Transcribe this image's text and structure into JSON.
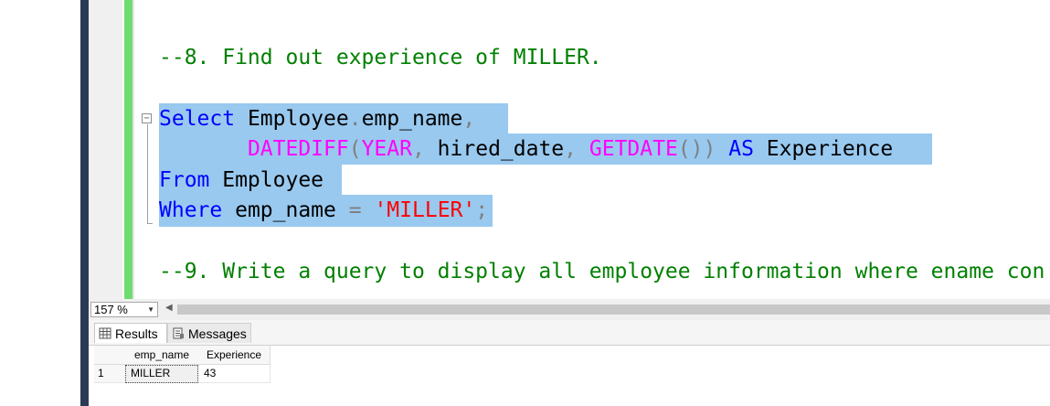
{
  "editor": {
    "lines": [
      [
        {
          "t": "--8. Find out experience of MILLER.",
          "c": "c-comment"
        }
      ],
      [
        {
          "t": "Select",
          "c": "c-kw"
        },
        {
          "t": " Employee",
          "c": "c-id"
        },
        {
          "t": ".",
          "c": "c-punct"
        },
        {
          "t": "emp_name",
          "c": "c-id"
        },
        {
          "t": ",",
          "c": "c-punct"
        }
      ],
      [
        {
          "t": "       ",
          "c": "c-id"
        },
        {
          "t": "DATEDIFF",
          "c": "c-fn"
        },
        {
          "t": "(",
          "c": "c-punct"
        },
        {
          "t": "YEAR",
          "c": "c-fn"
        },
        {
          "t": ",",
          "c": "c-punct"
        },
        {
          "t": " hired_date",
          "c": "c-id"
        },
        {
          "t": ",",
          "c": "c-punct"
        },
        {
          "t": " ",
          "c": "c-id"
        },
        {
          "t": "GETDATE",
          "c": "c-fn"
        },
        {
          "t": "())",
          "c": "c-punct"
        },
        {
          "t": " ",
          "c": "c-id"
        },
        {
          "t": "AS",
          "c": "c-kw"
        },
        {
          "t": " Experience",
          "c": "c-id"
        }
      ],
      [
        {
          "t": "From",
          "c": "c-kw"
        },
        {
          "t": " Employee",
          "c": "c-id"
        }
      ],
      [
        {
          "t": "Where",
          "c": "c-kw"
        },
        {
          "t": " emp_name ",
          "c": "c-id"
        },
        {
          "t": "=",
          "c": "c-punct"
        },
        {
          "t": " ",
          "c": "c-id"
        },
        {
          "t": "'MILLER'",
          "c": "c-str"
        },
        {
          "t": ";",
          "c": "c-punct"
        }
      ],
      [
        {
          "t": "--9. Write a query to display all employee information where ename con",
          "c": "c-comment"
        }
      ]
    ],
    "collapse_glyph": "−"
  },
  "status_bar": {
    "zoom": "157 %",
    "zoom_arrow": "▼",
    "scroll_left_arrow": "◀"
  },
  "results": {
    "tabs": [
      {
        "label": "Results",
        "icon": "grid-icon"
      },
      {
        "label": "Messages",
        "icon": "messages-icon"
      }
    ],
    "columns": [
      "emp_name",
      "Experience"
    ],
    "rows": [
      {
        "row_number": "1",
        "cells": [
          "MILLER",
          "43"
        ]
      }
    ]
  },
  "colors": {
    "selection": "#99c9ef",
    "comment": "#008000",
    "keyword": "#0000ff",
    "function": "#ff00ff",
    "string": "#ff0000",
    "change_bar": "#6fdc6f"
  }
}
